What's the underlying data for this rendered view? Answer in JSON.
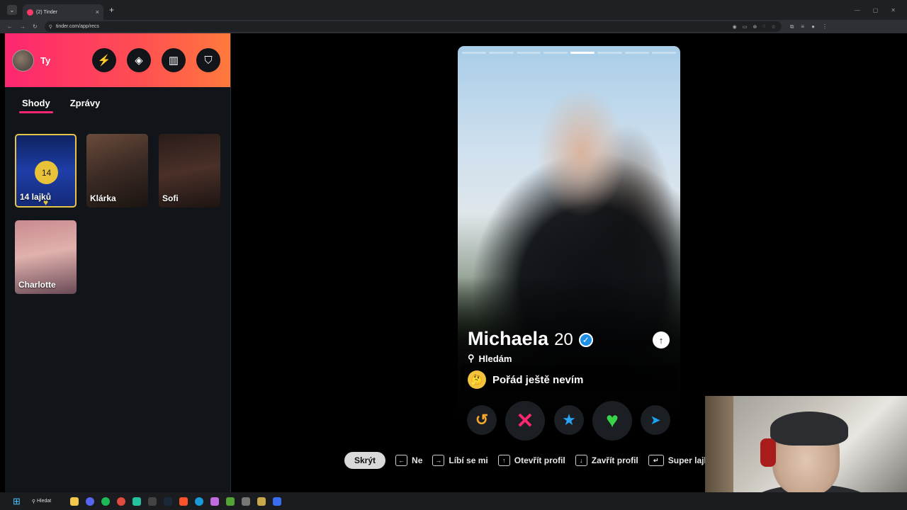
{
  "browser": {
    "tab_title": "(2) Tinder",
    "url": "tinder.com/app/recs",
    "tab_close": "×",
    "new_tab": "+"
  },
  "sidebar": {
    "user_label": "Ty",
    "header_icons": [
      "boost-icon",
      "explore-icon",
      "passport-icon",
      "safety-shield-icon"
    ],
    "tabs": [
      {
        "label": "Shody",
        "active": true
      },
      {
        "label": "Zprávy",
        "active": false
      }
    ],
    "likes_card": {
      "count": "14",
      "label": "14 lajků"
    },
    "matches": [
      {
        "name": "Klárka"
      },
      {
        "name": "Sofi"
      },
      {
        "name": "Charlotte"
      }
    ]
  },
  "profile": {
    "name": "Michaela",
    "age": "20",
    "verified": true,
    "looking_label": "Hledám",
    "intent": "Pořád ještě nevím",
    "photo_count": 8,
    "active_photo": 5
  },
  "actions": [
    "rewind-button",
    "nope-button",
    "super-like-button",
    "like-button",
    "boost-button"
  ],
  "shortcuts": {
    "hide_label": "Skrýt",
    "items": [
      {
        "key": "←",
        "label": "Ne"
      },
      {
        "key": "→",
        "label": "Líbí se mi"
      },
      {
        "key": "↑",
        "label": "Otevřít profil"
      },
      {
        "key": "↓",
        "label": "Zavřít profil"
      },
      {
        "key": "↵",
        "label": "Super lajk"
      }
    ]
  },
  "taskbar": {
    "search_label": "Hledat"
  },
  "colors": {
    "brand_pink": "#fd2670",
    "brand_orange": "#ff7a3d",
    "nope": "#fd2670",
    "like": "#39d34a",
    "super_like": "#2aa4f4",
    "rewind": "#f3a72b"
  }
}
